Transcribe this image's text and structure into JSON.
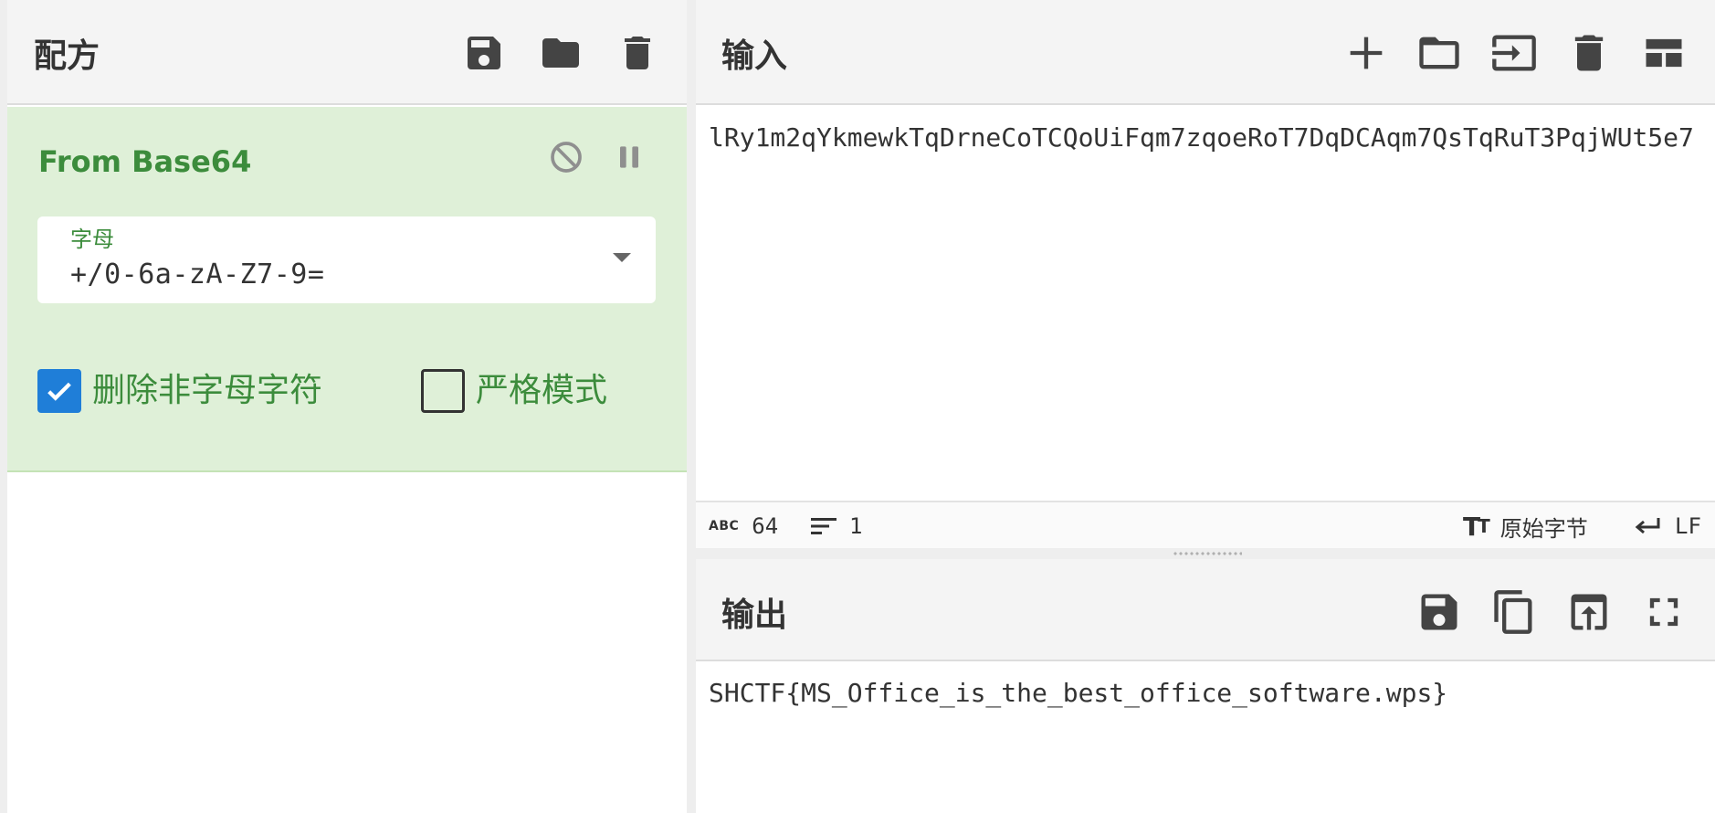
{
  "recipe": {
    "title": "配方",
    "buttons": [
      "save-icon",
      "folder-icon",
      "trash-icon"
    ],
    "operation": {
      "name": "From Base64",
      "argument": {
        "label": "字母",
        "value": "+/0-6a-zA-Z7-9="
      },
      "options": [
        {
          "label": "删除非字母字符",
          "checked": true
        },
        {
          "label": "严格模式",
          "checked": false
        }
      ]
    }
  },
  "input": {
    "title": "输入",
    "text": "lRy1m2qYkmewkTqDrneCoTCQoUiFqm7zqoeRoT7DqDCAqm7QsTqRuT3PqjWUt5e7",
    "status": {
      "length": "64",
      "lines": "1",
      "encoding": "原始字节",
      "eol": "LF"
    }
  },
  "output": {
    "title": "输出",
    "text": "SHCTF{MS_Office_is_the_best_office_software.wps}"
  },
  "colors": {
    "op_bg": "#dff0d8",
    "op_text": "#3c8c3c",
    "checkbox": "#1f7ed8"
  }
}
